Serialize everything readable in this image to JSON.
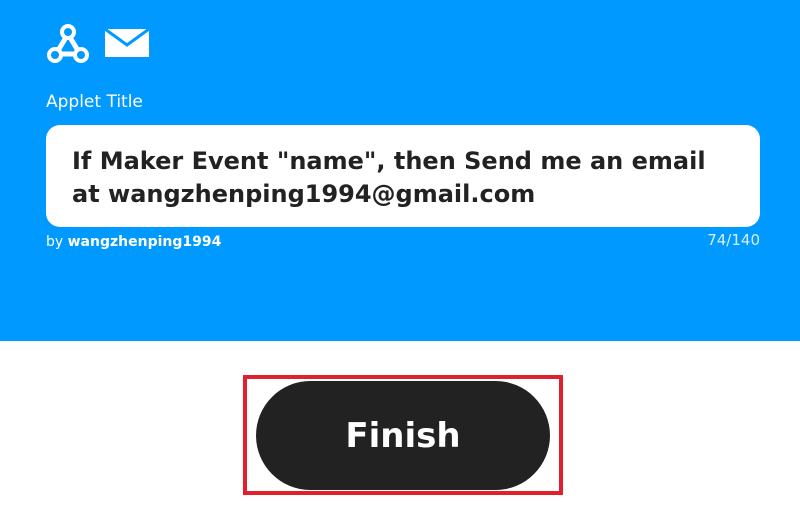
{
  "trigger": {
    "icon": "webhook-icon"
  },
  "action": {
    "icon": "email-icon"
  },
  "applet": {
    "title_label": "Applet Title",
    "title_value": "If Maker Event \"name\", then Send me an email at wangzhenping1994@gmail.com",
    "by_prefix": "by",
    "author": "wangzhenping1994",
    "char_count": "74/140"
  },
  "actions": {
    "finish_label": "Finish"
  },
  "colors": {
    "hero_bg": "#0099ff",
    "button_bg": "#222222",
    "highlight": "#e0202c"
  }
}
